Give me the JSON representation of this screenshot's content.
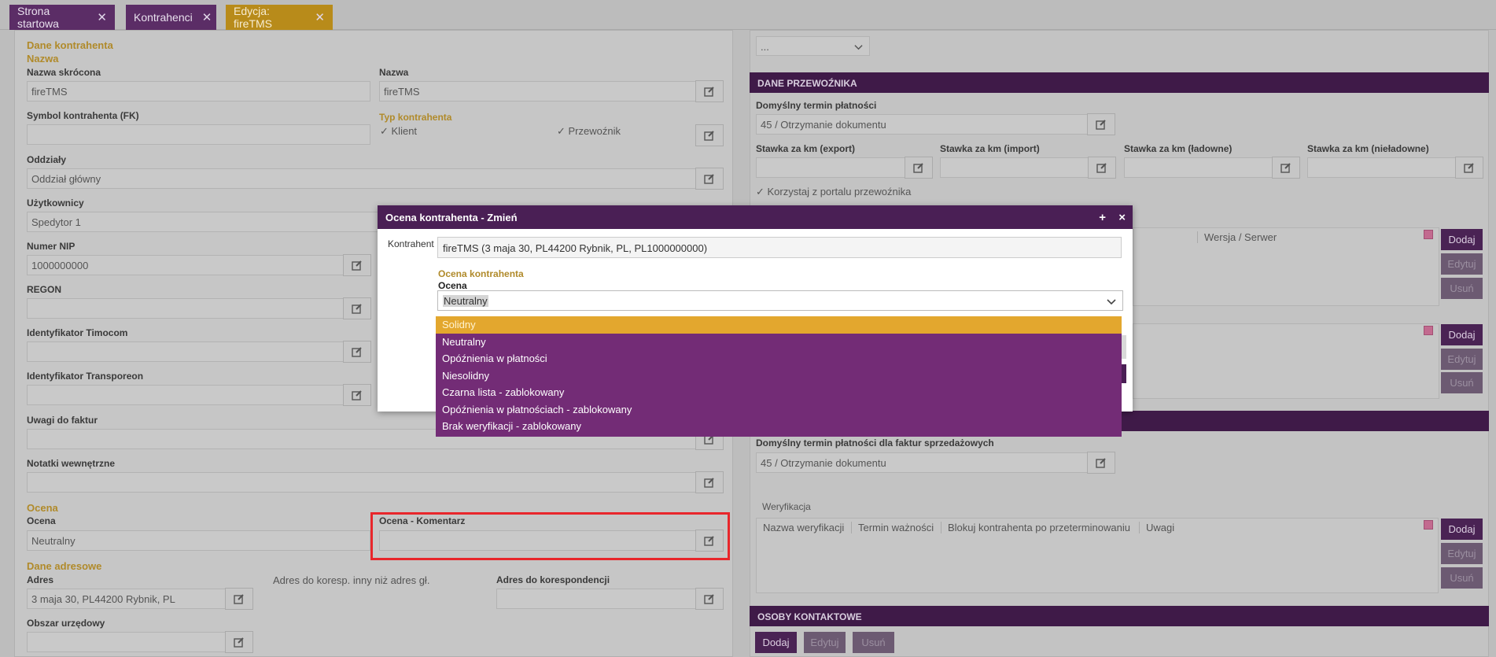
{
  "tabs": [
    {
      "label": "Strona startowa"
    },
    {
      "label": "Kontrahenci"
    },
    {
      "label": "Edycja: fireTMS"
    }
  ],
  "left": {
    "section_dane": "Dane kontrahenta",
    "section_nazwa": "Nazwa",
    "nazwa_skrocona_label": "Nazwa skrócona",
    "nazwa_skrocona_value": "fireTMS",
    "nazwa_label": "Nazwa",
    "nazwa_value": "fireTMS",
    "symbol_label": "Symbol kontrahenta (FK)",
    "typ_label": "Typ kontrahenta",
    "typ_klient": "Klient",
    "typ_przewoznik": "Przewoźnik",
    "oddzialy_label": "Oddziały",
    "oddzialy_value": "Oddział główny",
    "uzytkownicy_label": "Użytkownicy",
    "uzytkownicy_value": "Spedytor 1",
    "nip_label": "Numer NIP",
    "nip_value": "1000000000",
    "regon_label": "REGON",
    "timocom_label": "Identyfikator Timocom",
    "transporeon_label": "Identyfikator Transporeon",
    "uwagi_label": "Uwagi do faktur",
    "notatki_label": "Notatki wewnętrzne",
    "section_ocena": "Ocena",
    "ocena_label": "Ocena",
    "ocena_value": "Neutralny",
    "ocena_komentarz_label": "Ocena - Komentarz",
    "section_adresy": "Dane adresowe",
    "adres_label": "Adres",
    "adres_value": "3 maja 30, PL44200 Rybnik, PL",
    "adres_inny_label": "Adres do koresp. inny niż adres gł.",
    "adres_koresp_label": "Adres do korespondencji",
    "obszar_label": "Obszar urzędowy"
  },
  "right": {
    "top_select": "...",
    "dane_przewoznika_header": "DANE PRZEWOŹNIKA",
    "termin_label": "Domyślny termin płatności",
    "termin_value": "45 / Otrzymanie dokumentu",
    "stawka_export": "Stawka za km (export)",
    "stawka_import": "Stawka za km (import)",
    "stawka_ladowne": "Stawka za km (ładowne)",
    "stawka_nieladowne": "Stawka za km (nieładowne)",
    "portal_label": "Korzystaj z portalu przewoźnika",
    "wersja_col": "Wersja / Serwer",
    "termin_sprzedaz_label": "Domyślny termin płatności dla faktur sprzedażowych",
    "termin_sprzedaz_value": "45 / Otrzymanie dokumentu",
    "weryfikacja_label": "Weryfikacja",
    "wer_cols": [
      "Nazwa weryfikacji",
      "Termin ważności",
      "Blokuj kontrahenta po przeterminowaniu",
      "Uwagi"
    ],
    "osoby_header": "OSOBY KONTAKTOWE",
    "dodaj": "Dodaj",
    "edytuj": "Edytuj",
    "usun": "Usuń"
  },
  "modal": {
    "title": "Ocena kontrahenta - Zmień",
    "plus": "+",
    "close": "×",
    "kontrahent_label": "Kontrahent",
    "kontrahent_value": "fireTMS (3 maja 30, PL44200 Rybnik, PL, PL1000000000)",
    "section": "Ocena kontrahenta",
    "ocena_label": "Ocena",
    "selected": "Neutralny",
    "options": [
      "Solidny",
      "Neutralny",
      "Opóźnienia w płatności",
      "Niesolidny",
      "Czarna lista - zablokowany",
      "Opóźnienia w płatnościach - zablokowany",
      "Brak weryfikacji - zablokowany"
    ]
  },
  "colors": {
    "brand_purple": "#4a1f55",
    "accent_gold": "#b08a2a",
    "highlight_option": "#e3a72e",
    "dropdown_bg": "#732c76",
    "focus_frame": "#e8262b"
  }
}
